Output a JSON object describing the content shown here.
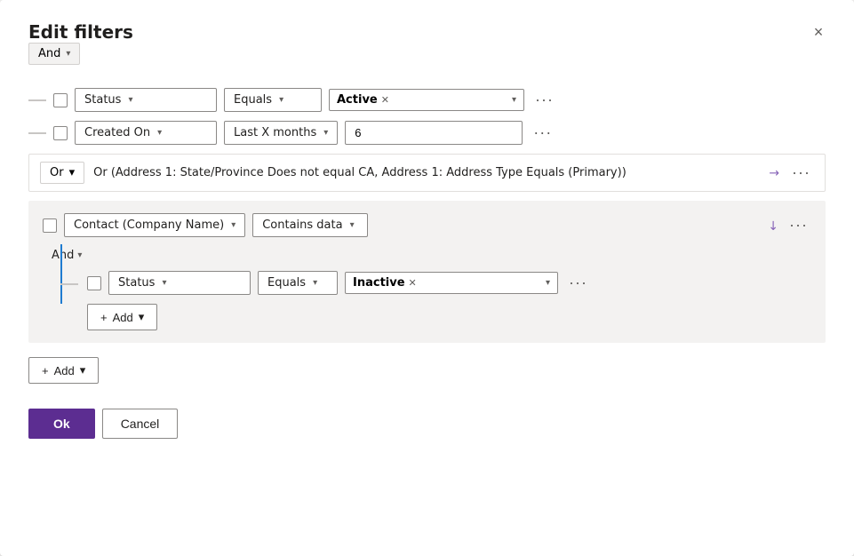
{
  "dialog": {
    "title": "Edit filters",
    "close_label": "×"
  },
  "top_operator": {
    "label": "And",
    "chevron": "▾"
  },
  "filter_rows": [
    {
      "id": "row1",
      "field": "Status",
      "operator": "Equals",
      "value_tag": "Active",
      "more": "···"
    },
    {
      "id": "row2",
      "field": "Created On",
      "operator": "Last X months",
      "value": "6",
      "more": "···"
    }
  ],
  "or_group": {
    "badge": "Or",
    "text": "Or (Address 1: State/Province Does not equal CA, Address 1: Address Type Equals (Primary))",
    "expand_icon": "↗",
    "more": "···"
  },
  "nested_group": {
    "field": "Contact (Company Name)",
    "operator": "Contains data",
    "collapse_icon": "↙",
    "more_header": "···",
    "and_label": "And",
    "inner_row": {
      "field": "Status",
      "operator": "Equals",
      "value_tag": "Inactive",
      "more": "···"
    },
    "add_btn": {
      "label": "Add",
      "plus": "+",
      "chevron": "▾"
    }
  },
  "bottom_add": {
    "label": "Add",
    "plus": "+",
    "chevron": "▾"
  },
  "footer": {
    "ok_label": "Ok",
    "cancel_label": "Cancel"
  }
}
